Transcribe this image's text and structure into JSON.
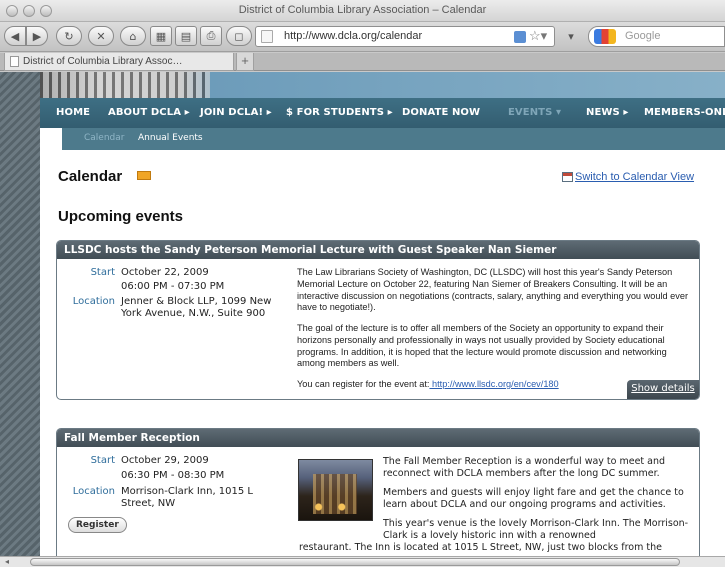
{
  "window": {
    "title": "District of Columbia Library Association – Calendar"
  },
  "toolbar": {
    "url": "http://www.dcla.org/calendar",
    "search_placeholder": "Google"
  },
  "tab": {
    "title": "District of Columbia Library Assoc…",
    "new_tab_label": "+"
  },
  "nav": {
    "items": [
      "HOME",
      "ABOUT DCLA ▸",
      "JOIN DCLA! ▸",
      "$ FOR STUDENTS ▸",
      "DONATE NOW",
      "EVENTS ▾",
      "NEWS ▸",
      "MEMBERS-ONLY"
    ],
    "active_index": 5
  },
  "subnav": {
    "items": [
      "Calendar",
      "Annual Events"
    ],
    "active_index": 0
  },
  "page": {
    "title": "Calendar",
    "switch_link": "Switch to Calendar View",
    "section_heading": "Upcoming events"
  },
  "events": [
    {
      "title": "LLSDC hosts the Sandy Peterson Memorial Lecture with Guest Speaker Nan Siemer",
      "start_label": "Start",
      "start_date": "October 22, 2009",
      "start_time": "06:00 PM - 07:30 PM",
      "location_label": "Location",
      "location_line1": "Jenner & Block LLP, 1099 New",
      "location_line2": "York Avenue, N.W., Suite 900",
      "paragraph1": "The Law Librarians Society of Washington, DC (LLSDC) will host this year's Sandy Peterson Memorial Lecture on October 22, featuring Nan Siemer of Breakers Consulting. It will be an interactive discussion on negotiations (contracts, salary, anything and everything you would ever have to negotiate!).",
      "paragraph2": "The goal of the lecture is to offer all members of the Society an opportunity to expand their horizons personally and professionally in ways not usually provided by Society educational programs. In addition, it is hoped that the lecture would promote discussion and networking among members as well.",
      "register_text": "You can register for the event at:",
      "register_link": " http://www.llsdc.org/en/cev/180",
      "show_details": "Show details"
    },
    {
      "title": "Fall Member Reception",
      "start_label": "Start",
      "start_date": "October 29, 2009",
      "start_time": "06:30 PM - 08:30 PM",
      "location_label": "Location",
      "location_line1": "Morrison-Clark Inn, 1015 L",
      "location_line2": "Street, NW",
      "register_button": "Register",
      "paragraph1": "The Fall Member Reception is a wonderful way to meet and reconnect with DCLA members after the long DC summer.",
      "paragraph2": "Members and guests will enjoy light fare and get the chance to learn about DCLA and our ongoing programs and activities.",
      "paragraph3a": "This year's venue is the lovely Morrison-Clark Inn.  The Morrison-Clark is a lovely historic inn with a renowned",
      "paragraph3b": "restaurant. The Inn is located at 1015 L Street, NW, just two blocks from the"
    }
  ]
}
